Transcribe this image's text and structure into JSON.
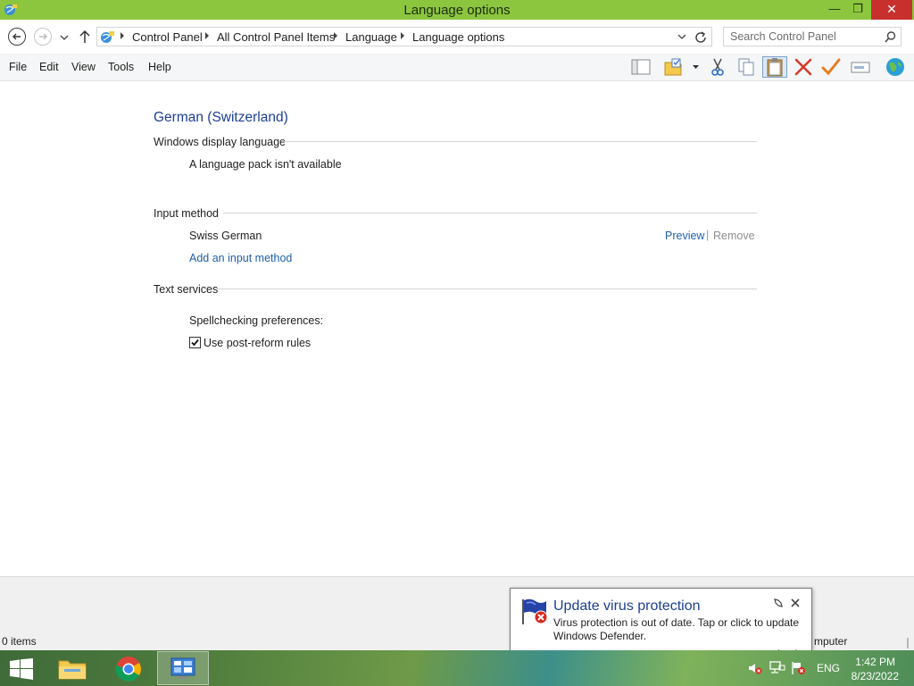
{
  "window": {
    "title": "Language options",
    "minimize_glyph": "—",
    "restore_glyph": "❐",
    "close_glyph": "✕"
  },
  "address": {
    "breadcrumbs": [
      "Control Panel",
      "All Control Panel Items",
      "Language",
      "Language options"
    ]
  },
  "search": {
    "placeholder": "Search Control Panel"
  },
  "menu": [
    "File",
    "Edit",
    "View",
    "Tools",
    "Help"
  ],
  "toolbar_icons": [
    "layout-icon",
    "folder-properties-icon",
    "cut-icon",
    "copy-icon",
    "paste-icon",
    "delete-icon",
    "check-icon",
    "rename-icon",
    "globe-icon"
  ],
  "content": {
    "language_name": "German (Switzerland)",
    "display_language": {
      "heading": "Windows display language",
      "status": "A language pack isn't available"
    },
    "input_method": {
      "heading": "Input method",
      "item": "Swiss German",
      "preview": "Preview",
      "separator": "|",
      "remove": "Remove",
      "add_link": "Add an input method"
    },
    "text_services": {
      "heading": "Text services",
      "spell_label": "Spellchecking preferences:",
      "post_reform": {
        "label": "Use post-reform rules",
        "checked": true
      }
    }
  },
  "status_bar": {
    "items": "0 items",
    "right_text": "mputer"
  },
  "notification": {
    "title": "Update virus protection",
    "body": "Virus protection is out of date. Tap or click to update Windows Defender."
  },
  "taskbar": {
    "language": "ENG",
    "time": "1:42 PM",
    "date": "8/23/2022"
  },
  "colors": {
    "titlebar": "#8cc63f",
    "close_button": "#c7302d",
    "link": "#1e5fae",
    "heading": "#1c3f94"
  }
}
